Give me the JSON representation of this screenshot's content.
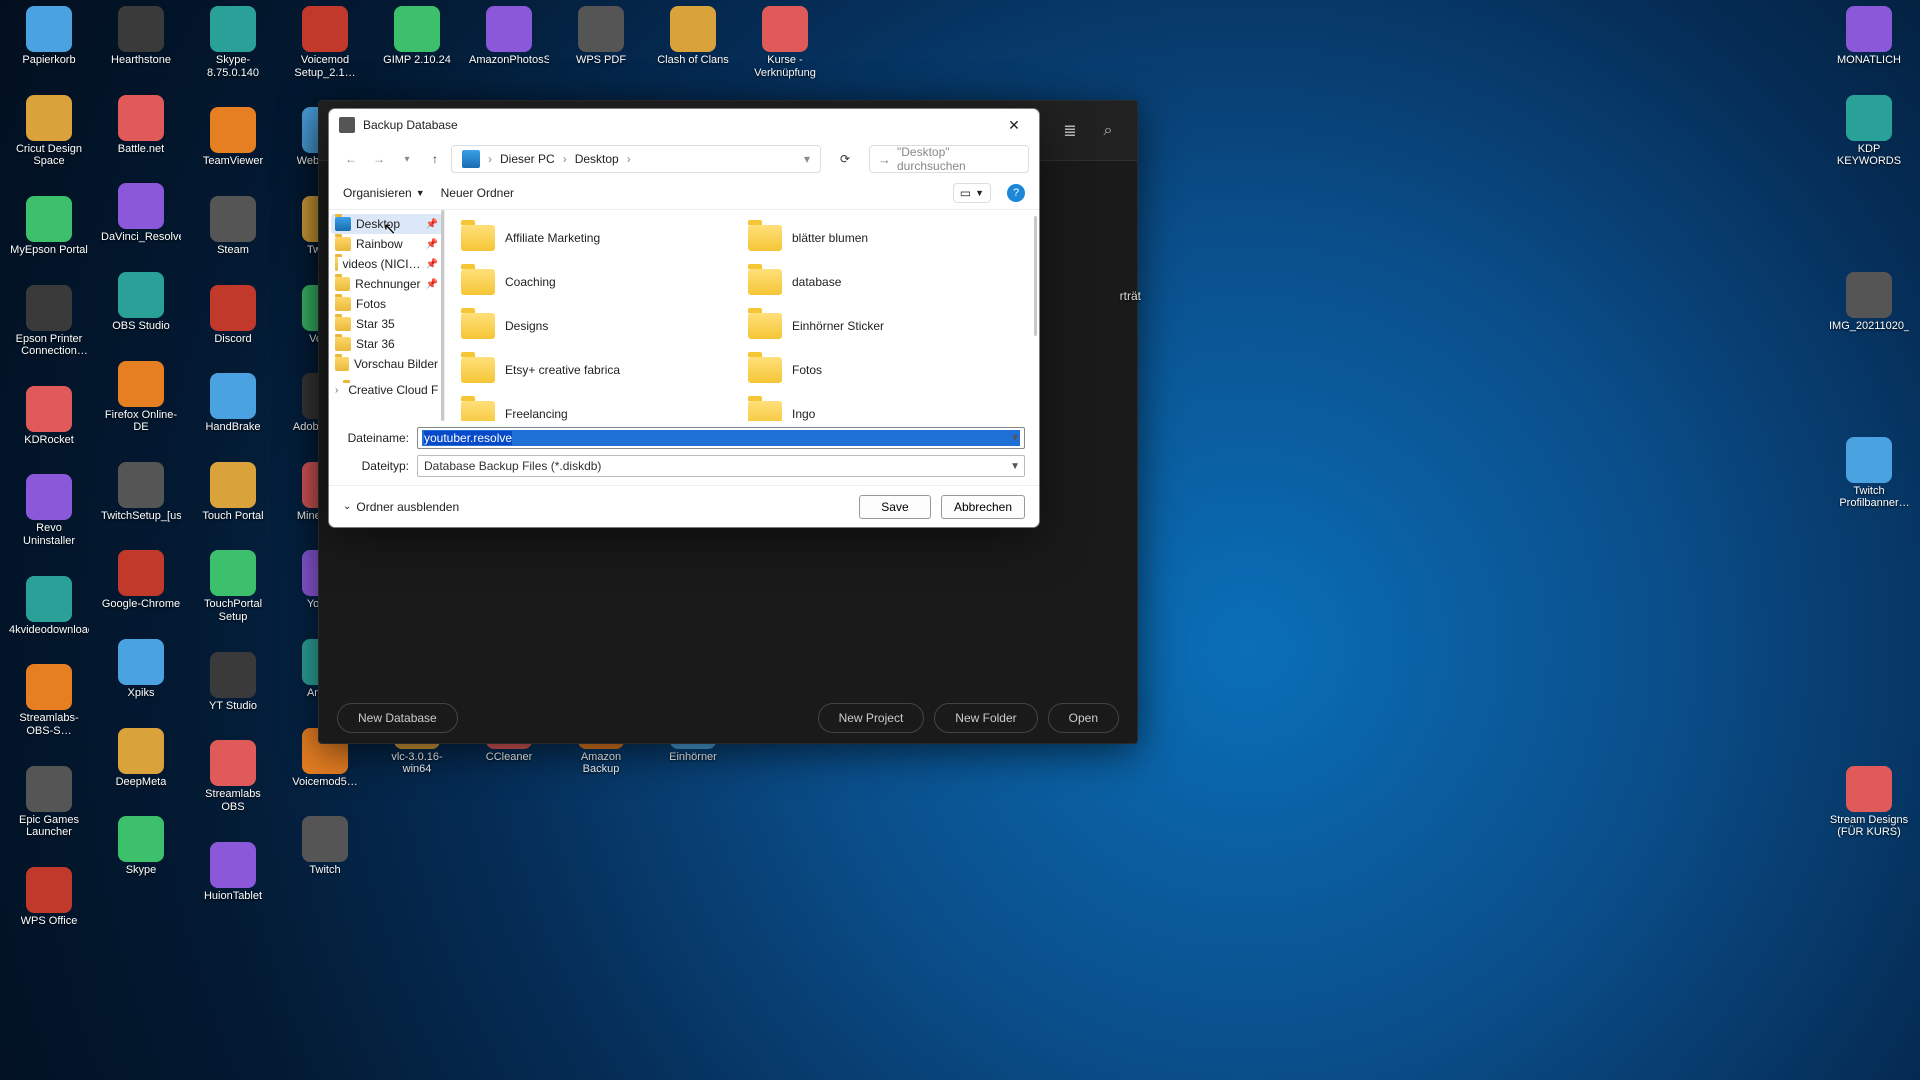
{
  "desktop_icons": {
    "c0": [
      "Papierkorb",
      "Cricut Design Space",
      "MyEpson Portal",
      "Epson Printer Connection Checker",
      "KDRocket",
      "Revo Uninstaller",
      "4kvideodownloade…",
      "Streamlabs-OBS-S…",
      "Epic Games Launcher",
      "WPS Office"
    ],
    "c1": [
      "Hearthstone",
      "Battle.net",
      "DaVinci_Resolve_16…",
      "OBS Studio",
      "Firefox Online-DE",
      "TwitchSetup_[usher…",
      "Google-Chrome",
      "Xpiks",
      "DeepMeta",
      "Skype"
    ],
    "c2": [
      "Skype-8.75.0.140",
      "TeamViewer",
      "Steam",
      "Discord",
      "HandBrake",
      "Touch Portal",
      "TouchPortal Setup",
      "YT Studio",
      "Streamlabs OBS",
      "HuionTablet"
    ],
    "c3": [
      "Voicemod Setup_2.1…",
      "WebCam…",
      "Twitc…",
      "Voic…",
      "Adobe-Cre…",
      "Minecraft…",
      "YouT…",
      "Anim…",
      "Voicemod5…",
      "Twitch"
    ],
    "c4": [
      "GIMP 2.10.24",
      "",
      "",
      "",
      "",
      "",
      "",
      "",
      "",
      "vlc-3.0.16-win64"
    ],
    "c5": [
      "AmazonPhotosSetup",
      "",
      "",
      "",
      "",
      "",
      "",
      "",
      "",
      "CCleaner"
    ],
    "c6": [
      "WPS PDF",
      "",
      "",
      "",
      "",
      "",
      "",
      "",
      "",
      "Amazon Backup"
    ],
    "c7": [
      "Clash of Clans",
      "",
      "",
      "",
      "",
      "",
      "",
      "",
      "",
      "Einhörner"
    ],
    "c8": [
      "Kurse - Verknüpfung"
    ],
    "right": [
      "MONATLICH",
      "KDP KEYWORDS",
      "",
      "IMG_20211020_14031",
      "",
      "Twitch Profilbanner template",
      "",
      "",
      "",
      "Stream Designs (FÜR KURS)"
    ]
  },
  "bg_app": {
    "buttons": {
      "new_db": "New Database",
      "new_project": "New Project",
      "new_folder": "New Folder",
      "open": "Open"
    },
    "clipped_label": "rträt"
  },
  "dialog": {
    "title": "Backup Database",
    "breadcrumbs": [
      "Dieser PC",
      "Desktop"
    ],
    "search_placeholder": "\"Desktop\" durchsuchen",
    "toolbar": {
      "organize": "Organisieren",
      "new_folder": "Neuer Ordner"
    },
    "tree": [
      {
        "label": "Desktop",
        "pinned": true,
        "selected": true,
        "icon": "desk"
      },
      {
        "label": "Rainbow",
        "pinned": true
      },
      {
        "label": "videos (NICI…",
        "pinned": true
      },
      {
        "label": "Rechnunger",
        "pinned": true
      },
      {
        "label": "Fotos"
      },
      {
        "label": "Star 35"
      },
      {
        "label": "Star 36"
      },
      {
        "label": "Vorschau Bilder"
      }
    ],
    "tree_cc": "Creative Cloud F",
    "folders_left": [
      "Affiliate Marketing",
      "Coaching",
      "Designs",
      "Etsy+ creative fabrica",
      "Freelancing"
    ],
    "folders_right": [
      "blätter blumen",
      "database",
      "Einhörner Sticker",
      "Fotos",
      "Ingo"
    ],
    "fields": {
      "name_label": "Dateiname:",
      "name_value": "youtuber.resolve",
      "type_label": "Dateityp:",
      "type_value": "Database Backup Files (*.diskdb)"
    },
    "footer": {
      "hide_folders": "Ordner ausblenden",
      "save": "Save",
      "cancel": "Abbrechen"
    }
  }
}
